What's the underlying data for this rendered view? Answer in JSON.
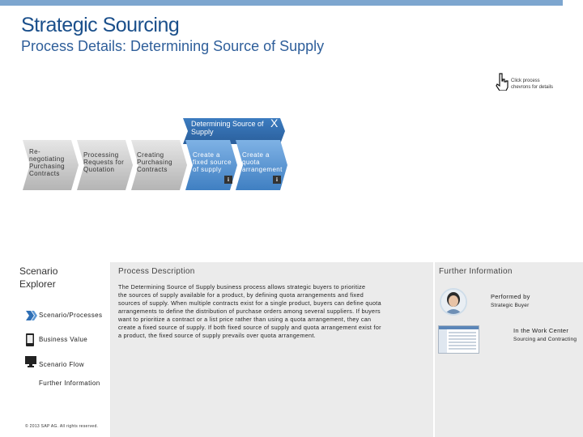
{
  "header": {
    "title": "Strategic Sourcing",
    "subtitle": "Process Details: Determining Source of Supply"
  },
  "hint": {
    "line1": "Click process",
    "line2": "chevrons for details",
    "icon": "hand-pointer-icon"
  },
  "process": {
    "steps": [
      {
        "line1": "Re-",
        "line2": "negotiating",
        "line3": "Purchasing",
        "line4": "Contracts"
      },
      {
        "line1": "Processing",
        "line2": "Requests for",
        "line3": "Quotation"
      },
      {
        "line1": "Creating",
        "line2": "Purchasing",
        "line3": "Contracts"
      }
    ],
    "phase": {
      "title_line1": "Determining Source of",
      "title_line2": "Supply",
      "close_symbol": "X",
      "substeps": [
        {
          "line1": "Create a",
          "line2": "fixed source",
          "line3": "of supply"
        },
        {
          "line1": "Create a",
          "line2": "quota",
          "line3": "arrangement"
        }
      ]
    },
    "info_symbol": "i"
  },
  "explorer": {
    "title_line1": "Scenario",
    "title_line2": "Explorer",
    "items": [
      {
        "label": "Scenario/Processes",
        "icon": "chevrons-icon"
      },
      {
        "label": "Business Value",
        "icon": "mobile-device-icon"
      },
      {
        "label": "Scenario Flow",
        "icon": "monitor-icon"
      },
      {
        "label": "Further Information",
        "icon": "document-icon"
      }
    ],
    "copyright": "© 2013 SAP AG. All rights reserved."
  },
  "description": {
    "title": "Process Description",
    "lines": [
      "The Determining Source of Supply business process allows strategic buyers to prioritize",
      "the sources of supply available for a product, by defining quota arrangements and fixed",
      "sources of supply. When multiple contracts exist for a single product, buyers can define quota",
      "arrangements to define the distribution of purchase orders among several suppliers. If buyers",
      "want to prioritize a contract or a list price rather than using a quota arrangement, they can",
      "create a fixed source of supply. If both fixed source of supply and quota arrangement exist for",
      "a product, the fixed source of supply prevails over quota arrangement."
    ]
  },
  "further": {
    "title": "Further Information",
    "performed_label": "Performed by",
    "performed_value": "Strategic Buyer",
    "workcenter_label": "In the Work Center",
    "workcenter_value": "Sourcing and Contracting"
  },
  "colors": {
    "accent": "#4d90d0",
    "phase": "#2f6fb5",
    "inactive_chevron": "#b8b8b8",
    "title": "#1a4f8b"
  }
}
